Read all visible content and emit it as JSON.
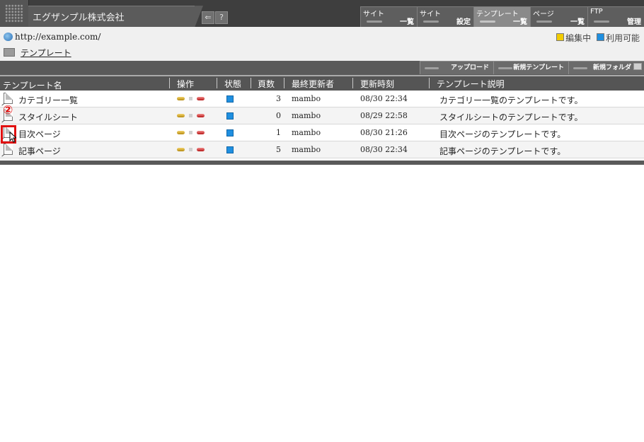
{
  "header": {
    "company": "エグザンプル株式会社",
    "icons": [
      "back-icon",
      "help-icon"
    ],
    "help_glyph": "?",
    "back_glyph": "⇐"
  },
  "nav": [
    {
      "top": "サイト",
      "bottom": "一覧",
      "active": false
    },
    {
      "top": "サイト",
      "bottom": "設定",
      "active": false
    },
    {
      "top": "テンプレート",
      "bottom": "一覧",
      "active": true
    },
    {
      "top": "ページ",
      "bottom": "一覧",
      "active": false
    },
    {
      "top": "FTP",
      "bottom": "管理",
      "active": false
    }
  ],
  "info": {
    "site_url": "http://example.com/",
    "folder": "テンプレート",
    "legend_editing": "編集中",
    "legend_available": "利用可能",
    "legend_colors": {
      "editing": "#f2cc00",
      "available": "#1f8fe0"
    }
  },
  "actions": {
    "upload": "アップロード",
    "new_template": "新規テンプレート",
    "new_folder": "新規フォルダ"
  },
  "table": {
    "headers": {
      "name": "テンプレート名",
      "ops": "操作",
      "status": "状態",
      "pages": "頁数",
      "updated_by": "最終更新者",
      "updated_at": "更新時刻",
      "description": "テンプレート説明"
    },
    "rows": [
      {
        "name": "カテゴリー一覧",
        "pages": "3",
        "user": "mambo",
        "time": "08/30 22:34",
        "desc": "カテゴリー一覧のテンプレートです。"
      },
      {
        "name": "スタイルシート",
        "pages": "0",
        "user": "mambo",
        "time": "08/29 22:58",
        "desc": "スタイルシートのテンプレートです。"
      },
      {
        "name": "目次ページ",
        "pages": "1",
        "user": "mambo",
        "time": "08/30 21:26",
        "desc": "目次ページのテンプレートです。"
      },
      {
        "name": "記事ページ",
        "pages": "5",
        "user": "mambo",
        "time": "08/30 22:34",
        "desc": "記事ページのテンプレートです。"
      }
    ]
  },
  "annotation": {
    "step_label": "②",
    "color": "#e01010"
  }
}
